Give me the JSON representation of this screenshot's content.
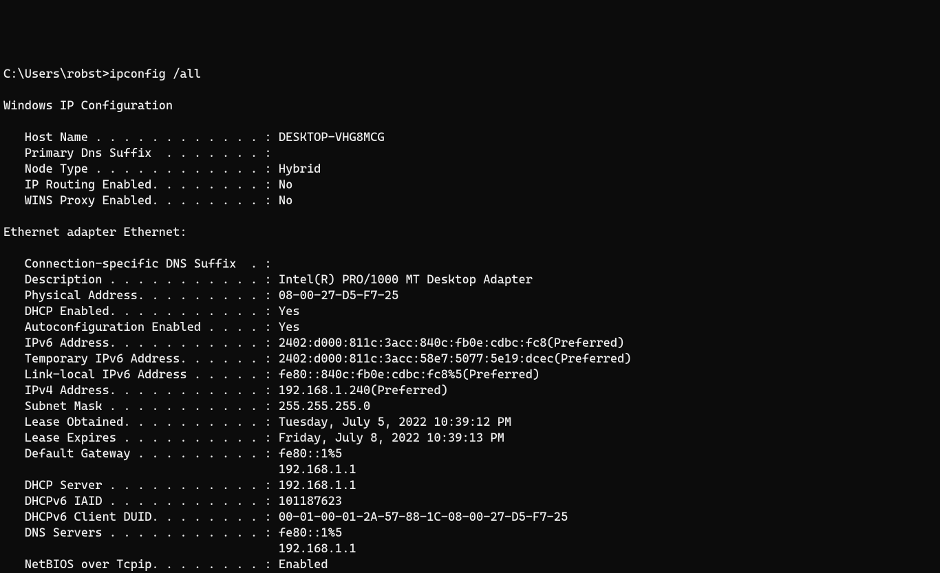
{
  "prompt": "C:\\Users\\robst>",
  "command": "ipconfig /all",
  "section1_header": "Windows IP Configuration",
  "win_config": {
    "host_name": "   Host Name . . . . . . . . . . . . : DESKTOP-VHG8MCG",
    "primary_dns_suffix": "   Primary Dns Suffix  . . . . . . . :",
    "node_type": "   Node Type . . . . . . . . . . . . : Hybrid",
    "ip_routing": "   IP Routing Enabled. . . . . . . . : No",
    "wins_proxy": "   WINS Proxy Enabled. . . . . . . . : No"
  },
  "section2_header": "Ethernet adapter Ethernet:",
  "eth": {
    "conn_dns": "   Connection-specific DNS Suffix  . :",
    "description": "   Description . . . . . . . . . . . : Intel(R) PRO/1000 MT Desktop Adapter",
    "phys_addr": "   Physical Address. . . . . . . . . : 08-00-27-D5-F7-25",
    "dhcp_enabled": "   DHCP Enabled. . . . . . . . . . . : Yes",
    "autoconf": "   Autoconfiguration Enabled . . . . : Yes",
    "ipv6": "   IPv6 Address. . . . . . . . . . . : 2402:d000:811c:3acc:840c:fb0e:cdbc:fc8(Preferred)",
    "temp_ipv6": "   Temporary IPv6 Address. . . . . . : 2402:d000:811c:3acc:58e7:5077:5e19:dcec(Preferred)",
    "link_local": "   Link-local IPv6 Address . . . . . : fe80::840c:fb0e:cdbc:fc8%5(Preferred)",
    "ipv4": "   IPv4 Address. . . . . . . . . . . : 192.168.1.240(Preferred)",
    "subnet": "   Subnet Mask . . . . . . . . . . . : 255.255.255.0",
    "lease_obt": "   Lease Obtained. . . . . . . . . . : Tuesday, July 5, 2022 10:39:12 PM",
    "lease_exp": "   Lease Expires . . . . . . . . . . : Friday, July 8, 2022 10:39:13 PM",
    "gateway1": "   Default Gateway . . . . . . . . . : fe80::1%5",
    "gateway2": "                                       192.168.1.1",
    "dhcp_server": "   DHCP Server . . . . . . . . . . . : 192.168.1.1",
    "dhcpv6_iaid": "   DHCPv6 IAID . . . . . . . . . . . : 101187623",
    "dhcpv6_duid": "   DHCPv6 Client DUID. . . . . . . . : 00-01-00-01-2A-57-88-1C-08-00-27-D5-F7-25",
    "dns1": "   DNS Servers . . . . . . . . . . . : fe80::1%5",
    "dns2": "                                       192.168.1.1",
    "netbios": "   NetBIOS over Tcpip. . . . . . . . : Enabled"
  }
}
